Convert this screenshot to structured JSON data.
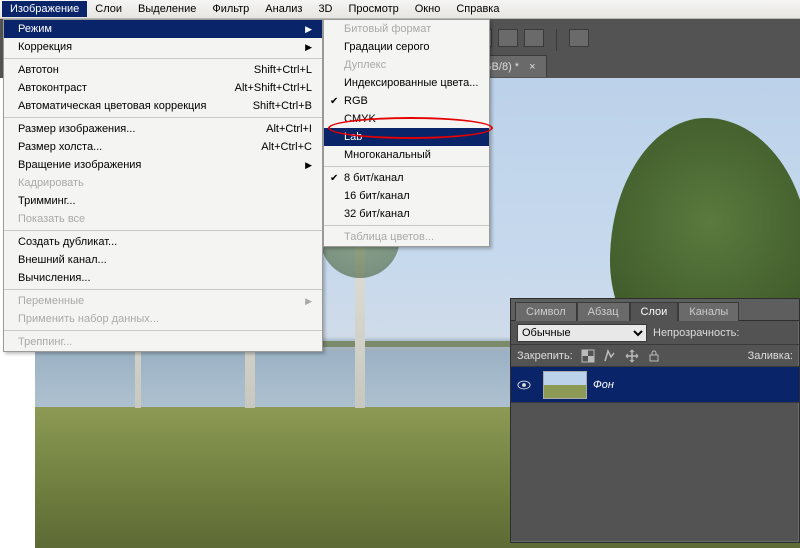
{
  "menubar": {
    "items": [
      "Изображение",
      "Слои",
      "Выделение",
      "Фильтр",
      "Анализ",
      "3D",
      "Просмотр",
      "Окно",
      "Справка"
    ],
    "selected_index": 0
  },
  "doc_tab": {
    "label": "GB/8) *",
    "close": "×"
  },
  "dropdown": {
    "groups": [
      [
        {
          "label": "Режим",
          "arrow": true,
          "selected": true
        },
        {
          "label": "Коррекция",
          "arrow": true
        }
      ],
      [
        {
          "label": "Автотон",
          "shortcut": "Shift+Ctrl+L"
        },
        {
          "label": "Автоконтраст",
          "shortcut": "Alt+Shift+Ctrl+L"
        },
        {
          "label": "Автоматическая цветовая коррекция",
          "shortcut": "Shift+Ctrl+B"
        }
      ],
      [
        {
          "label": "Размер изображения...",
          "shortcut": "Alt+Ctrl+I"
        },
        {
          "label": "Размер холста...",
          "shortcut": "Alt+Ctrl+C"
        },
        {
          "label": "Вращение изображения",
          "arrow": true
        },
        {
          "label": "Кадрировать",
          "disabled": true
        },
        {
          "label": "Тримминг..."
        },
        {
          "label": "Показать все",
          "disabled": true
        }
      ],
      [
        {
          "label": "Создать дубликат..."
        },
        {
          "label": "Внешний канал..."
        },
        {
          "label": "Вычисления..."
        }
      ],
      [
        {
          "label": "Переменные",
          "arrow": true,
          "disabled": true
        },
        {
          "label": "Применить набор данных...",
          "disabled": true
        }
      ],
      [
        {
          "label": "Треппинг...",
          "disabled": true
        }
      ]
    ]
  },
  "submenu": {
    "groups": [
      [
        {
          "label": "Битовый формат",
          "disabled": true
        },
        {
          "label": "Градации серого"
        },
        {
          "label": "Дуплекс",
          "disabled": true
        },
        {
          "label": "Индексированные цвета..."
        },
        {
          "label": "RGB",
          "checked": true
        },
        {
          "label": "CMYK"
        },
        {
          "label": "Lab",
          "selected": true
        },
        {
          "label": "Многоканальный"
        }
      ],
      [
        {
          "label": "8 бит/канал",
          "checked": true
        },
        {
          "label": "16 бит/канал"
        },
        {
          "label": "32 бит/канал"
        }
      ],
      [
        {
          "label": "Таблица цветов...",
          "disabled": true
        }
      ]
    ]
  },
  "panel": {
    "tabs": [
      "Символ",
      "Абзац",
      "Слои",
      "Каналы"
    ],
    "active_tab_index": 2,
    "blend_mode": "Обычные",
    "opacity_label": "Непрозрачность:",
    "lock_label": "Закрепить:",
    "fill_label": "Заливка:",
    "layers": [
      {
        "name": "Фон"
      }
    ]
  }
}
